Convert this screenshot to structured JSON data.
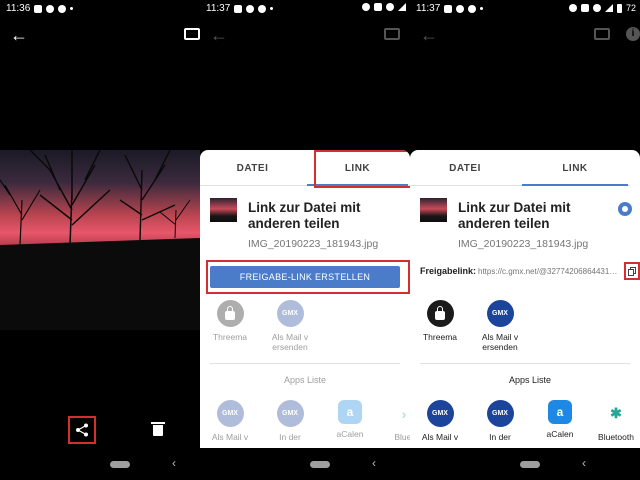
{
  "status_times": [
    "11:36",
    "11:37",
    "11:37"
  ],
  "battery_text": "72",
  "sheet": {
    "tab_file": "DATEI",
    "tab_link": "LINK",
    "title": "Link zur Datei mit anderen teilen",
    "filename": "IMG_20190223_181943.jpg",
    "create_link_button": "FREIGABE-LINK ERSTELLEN",
    "share_link_label": "Freigabelink:",
    "share_link_url": "https://c.gmx.net/@327742068644319003/...",
    "apps_list_title": "Apps Liste"
  },
  "direct_apps": [
    {
      "label": "Threema",
      "icon": "threema-icon"
    },
    {
      "label": "Als Mail v ersenden",
      "icon": "gmx-icon",
      "icon_text": "GMX"
    }
  ],
  "apps_list": [
    {
      "label": "Als Mail v",
      "icon": "gmx-icon",
      "icon_text": "GMX"
    },
    {
      "label": "In der",
      "icon": "gmx-icon",
      "icon_text": "GMX"
    },
    {
      "label": "aCalen",
      "icon": "acalendar-icon",
      "icon_text": "a"
    },
    {
      "label": "Bluetooth",
      "icon": "bluetooth-icon",
      "icon_text": "✱"
    }
  ],
  "panel2_apps_list_partial_label": "Bluet",
  "colors": {
    "accent": "#4a7cc9",
    "highlight_box": "#d32f2f",
    "gmx": "#1c449b"
  }
}
